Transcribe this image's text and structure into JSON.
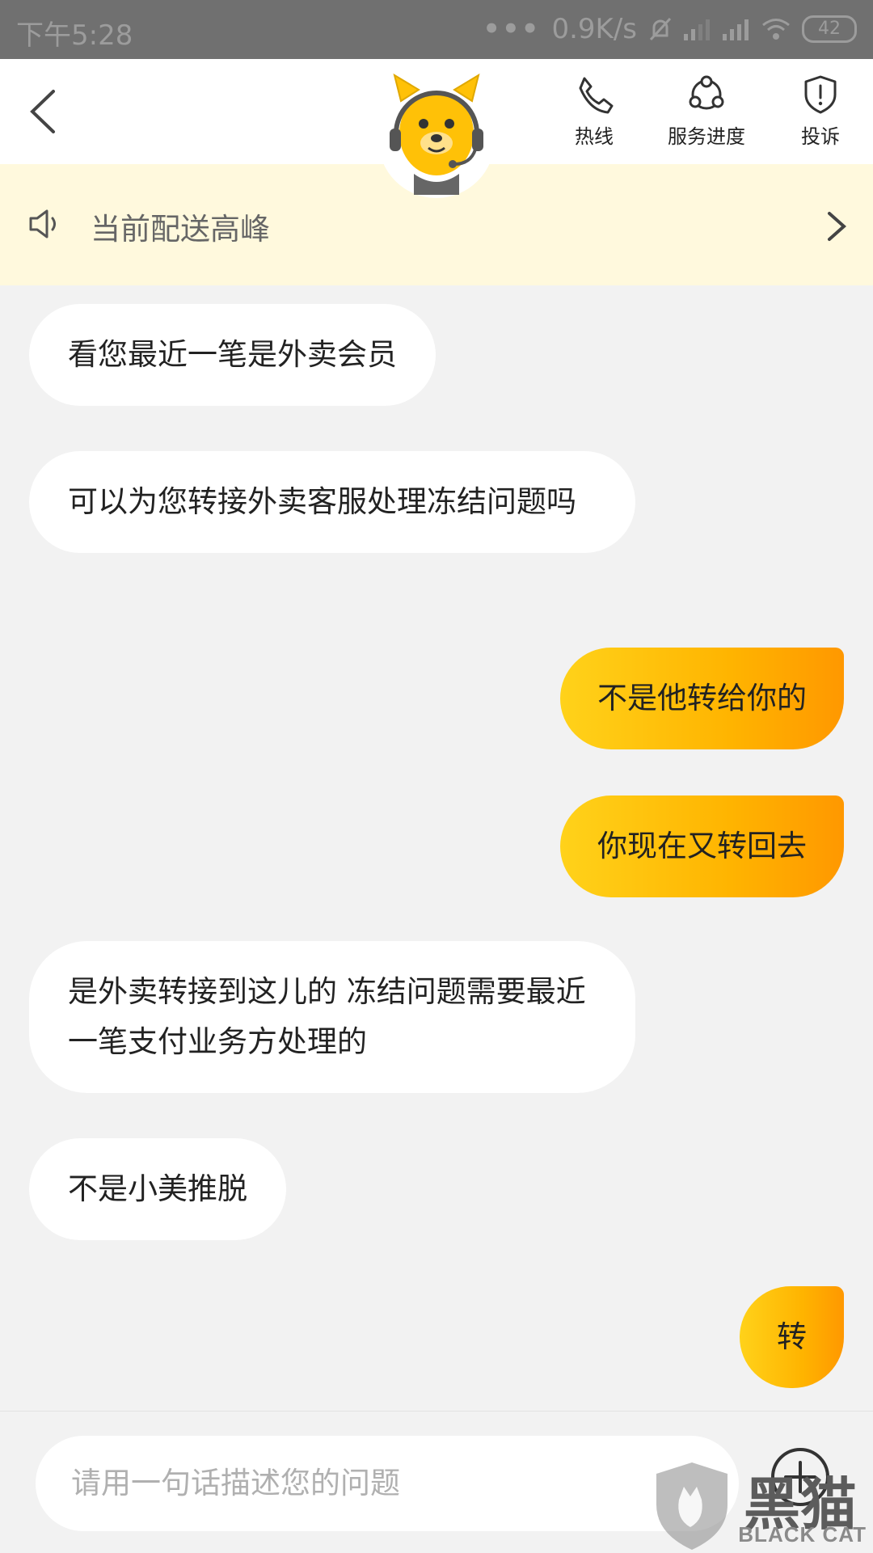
{
  "status_bar": {
    "time": "下午5:28",
    "dots": "•••",
    "speed": "0.9K/s",
    "battery": "42"
  },
  "header": {
    "buttons": [
      {
        "label": "热线",
        "icon": "phone-icon"
      },
      {
        "label": "服务进度",
        "icon": "progress-icon"
      },
      {
        "label": "投诉",
        "icon": "shield-icon"
      }
    ]
  },
  "notice": {
    "text": "当前配送高峰"
  },
  "messages": [
    {
      "side": "left",
      "text": "看您最近一笔是外卖会员"
    },
    {
      "side": "left",
      "text": "可以为您转接外卖客服处理冻结问题吗"
    },
    {
      "side": "right",
      "text": "不是他转给你的"
    },
    {
      "side": "right",
      "text": "你现在又转回去"
    },
    {
      "side": "left",
      "text": "是外卖转接到这儿的 冻结问题需要最近一笔支付业务方处理的"
    },
    {
      "side": "left",
      "text": "不是小美推脱"
    },
    {
      "side": "right",
      "text": "转"
    }
  ],
  "input": {
    "placeholder": "请用一句话描述您的问题"
  },
  "watermark": {
    "big": "黑猫",
    "small": "BLACK CAT"
  },
  "colors": {
    "accent": "#ffc107",
    "gradient_start": "#ffd21a",
    "gradient_end": "#ff9800",
    "notice_bg": "#fff9dd"
  }
}
